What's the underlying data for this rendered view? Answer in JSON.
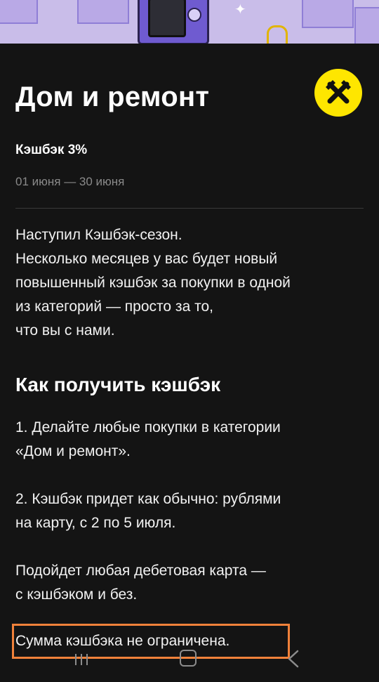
{
  "header": {
    "title": "Дом и ремонт",
    "logo_icon": "raiffeisen-logo-icon"
  },
  "offer": {
    "cashback": "Кэшбэк 3%",
    "dates": "01 июня — 30 июня"
  },
  "intro": {
    "lines": [
      "Наступил Кэшбэк-сезон.",
      "Несколько месяцев у вас будет новый",
      "повышенный кэшбэк за покупки в одной",
      "из категорий — просто за то,",
      "что вы с нами."
    ]
  },
  "how_to": {
    "title": "Как получить кэшбэк",
    "step1": [
      "1. Делайте любые покупки в категории",
      "«Дом и ремонт»."
    ],
    "step2": [
      "2. Кэшбэк придет как обычно: рублями",
      "на карту, с 2 по 5 июля."
    ],
    "card_note": [
      "Подойдет любая дебетовая карта —",
      "с кэшбэком и без."
    ],
    "limit_note": "Сумма кэшбэка не ограничена."
  },
  "nav": {
    "recent_icon": "recent-apps-icon",
    "home_icon": "home-icon",
    "back_icon": "back-icon"
  },
  "colors": {
    "background": "#141414",
    "accent_yellow": "#fee600",
    "highlight_border": "#f0813a",
    "muted_text": "#8a8a8a"
  }
}
